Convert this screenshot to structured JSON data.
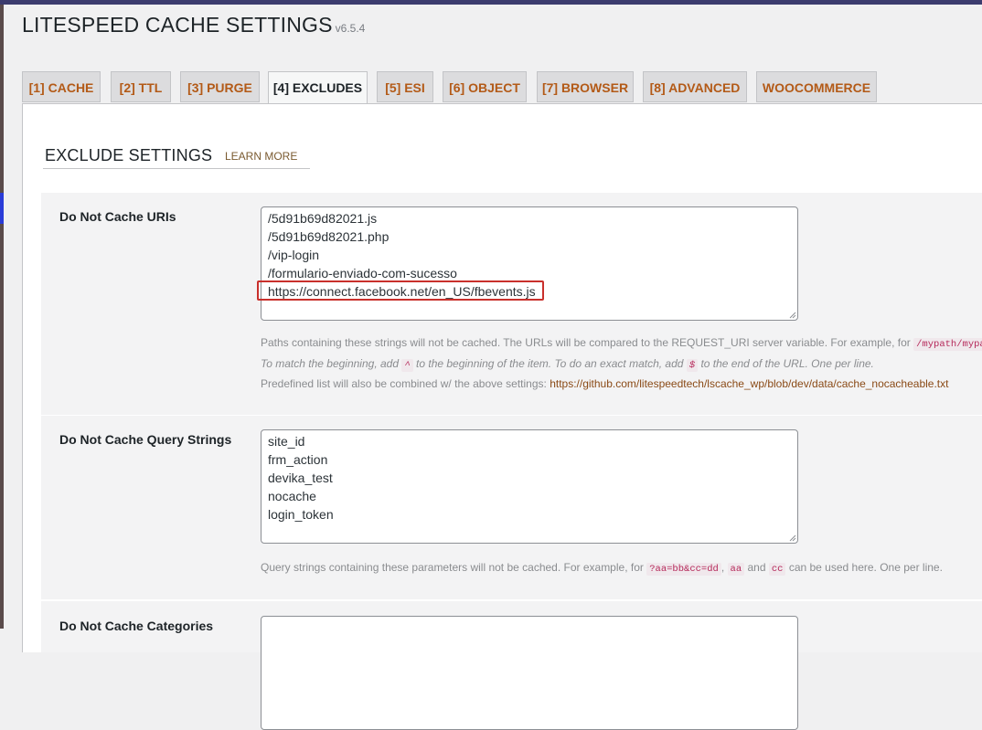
{
  "header": {
    "title": "LITESPEED CACHE SETTINGS",
    "version": "v6.5.4"
  },
  "tabs": [
    {
      "label": "[1] CACHE",
      "active": false
    },
    {
      "label": "[2] TTL",
      "active": false
    },
    {
      "label": "[3] PURGE",
      "active": false
    },
    {
      "label": "[4] EXCLUDES",
      "active": true
    },
    {
      "label": "[5] ESI",
      "active": false
    },
    {
      "label": "[6] OBJECT",
      "active": false
    },
    {
      "label": "[7] BROWSER",
      "active": false
    },
    {
      "label": "[8] ADVANCED",
      "active": false
    },
    {
      "label": "WOOCOMMERCE",
      "active": false
    }
  ],
  "section": {
    "title": "EXCLUDE SETTINGS",
    "learn_more": "LEARN MORE"
  },
  "uris": {
    "label": "Do Not Cache URIs",
    "lines": [
      "/5d91b69d82021.js",
      "/5d91b69d82021.php",
      "/vip-login",
      "/formulario-enviado-com-sucesso",
      "https://connect.facebook.net/en_US/fbevents.js"
    ],
    "highlighted_line": "https://connect.facebook.net/en_US/fbevents.js",
    "desc1": "Paths containing these strings will not be cached. The URLs will be compared to the REQUEST_URI server variable. For example, for",
    "desc1_code": "/mypath/mypage",
    "desc2_a": "To match the beginning, add",
    "desc2_code1": "^",
    "desc2_b": "to the beginning of the item. To do an exact match, add",
    "desc2_code2": "$",
    "desc2_c": "to the end of the URL. One per line.",
    "desc3": "Predefined list will also be combined w/ the above settings:",
    "desc3_link": "https://github.com/litespeedtech/lscache_wp/blob/dev/data/cache_nocacheable.txt"
  },
  "query": {
    "label": "Do Not Cache Query Strings",
    "lines": [
      "site_id",
      "frm_action",
      "devika_test",
      "nocache",
      "login_token"
    ],
    "desc_a": "Query strings containing these parameters will not be cached. For example, for",
    "desc_code1": "?aa=bb&cc=dd",
    "desc_sep": ",",
    "desc_code2": "aa",
    "desc_and": "and",
    "desc_code3": "cc",
    "desc_b": "can be used here. One per line."
  },
  "categories": {
    "label": "Do Not Cache Categories"
  }
}
